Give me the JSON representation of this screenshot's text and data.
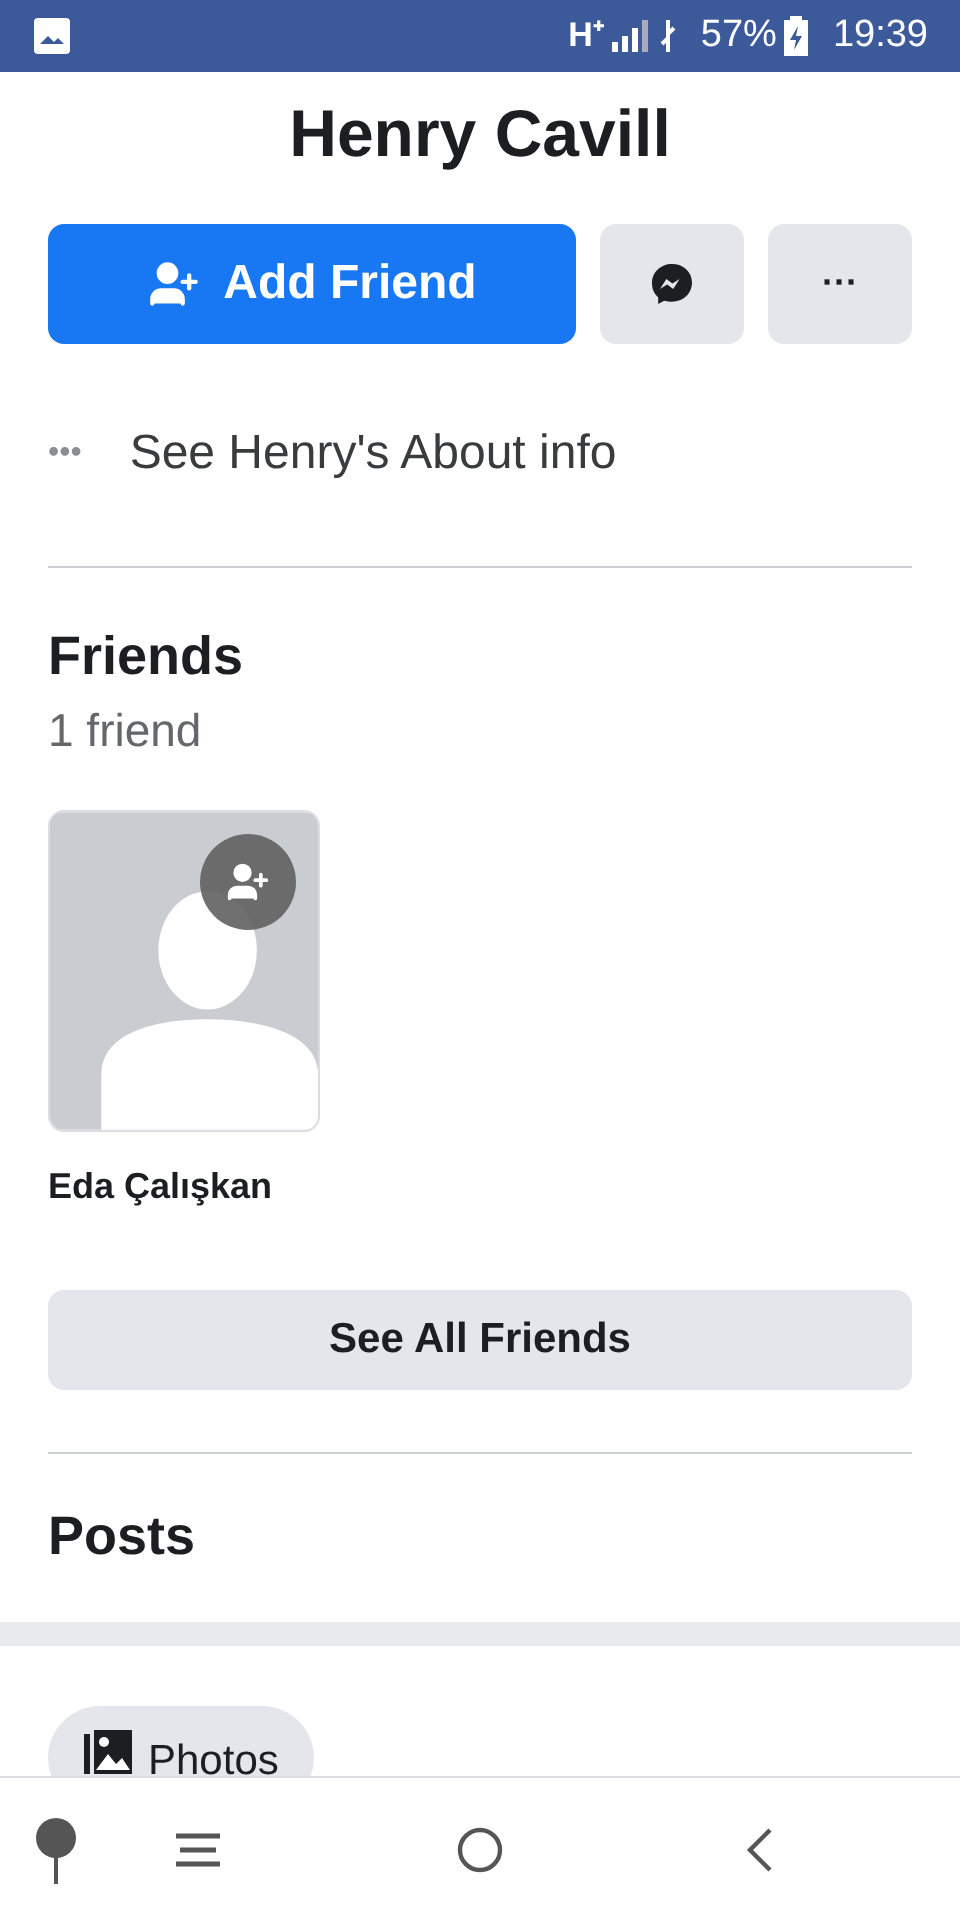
{
  "status_bar": {
    "network": "H⁺",
    "battery": "57%",
    "time": "19:39"
  },
  "profile": {
    "name": "Henry Cavill"
  },
  "actions": {
    "add_friend": "Add Friend",
    "more": "···"
  },
  "about": {
    "icon": "•••",
    "label": "See Henry's About info"
  },
  "friends": {
    "title": "Friends",
    "count": "1 friend",
    "items": [
      {
        "name": "Eda Çalışkan"
      }
    ],
    "see_all": "See All Friends"
  },
  "posts": {
    "title": "Posts",
    "chips": [
      {
        "label": "Photos"
      }
    ]
  }
}
